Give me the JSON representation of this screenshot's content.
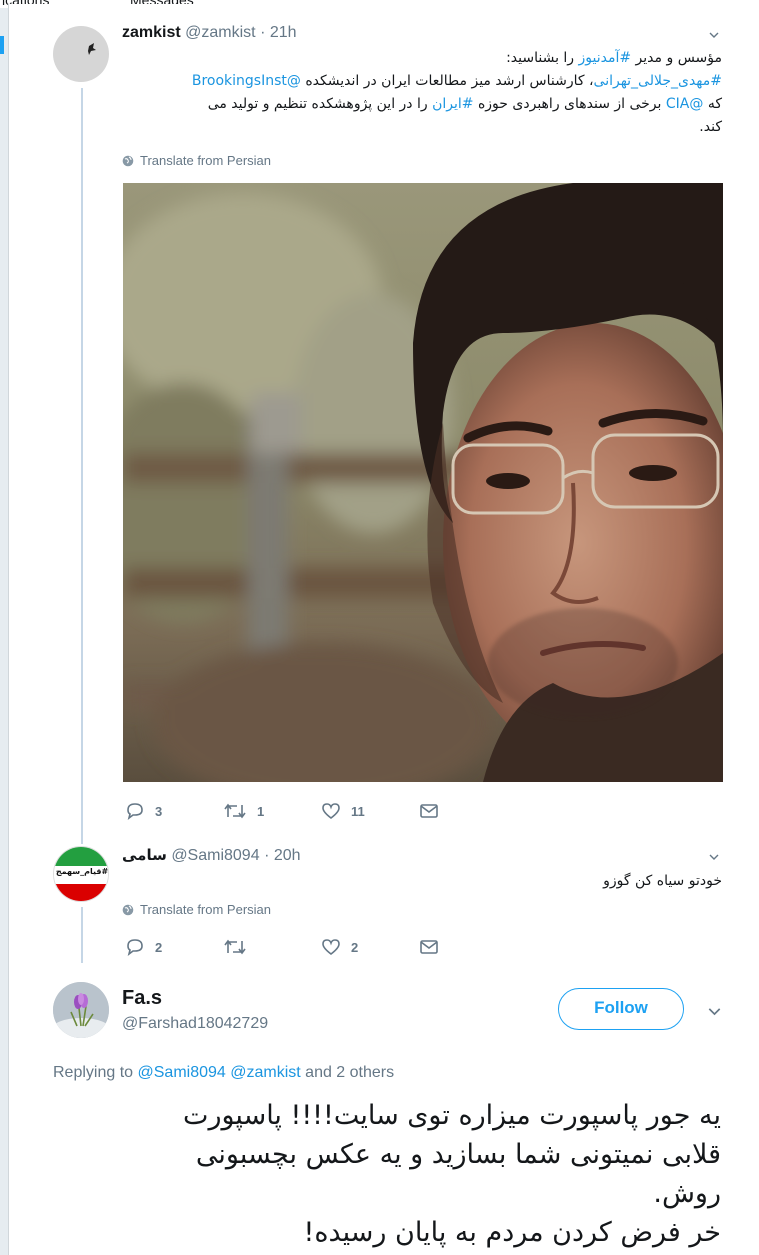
{
  "topbar": {
    "tab_notifications": "ications",
    "tab_messages": "Messages"
  },
  "tweet1": {
    "name": "zamkist",
    "handle": "@zamkist",
    "time": "· 21h",
    "line1_text": "مؤسس و مدیر ",
    "line1_link": "#آمدنیوز",
    "line1_end": " را بشناسید:",
    "line2_link1": "#مهدی_جلالی_تهرانی",
    "line2_text": "، کارشناس ارشد میز مطالعات ایران در اندیشکده ",
    "line2_link2": "@BrookingsInst",
    "line3_a": "که ",
    "line3_link1": "@CIA",
    "line3_b": " برخی از سندهای راهبردی حوزه ",
    "line3_link2": "#ایران",
    "line3_c": " را در این پژوهشکده تنظیم و تولید می",
    "line4": "کند.",
    "translate": "Translate from Persian",
    "replies": "3",
    "retweets": "1",
    "likes": "11"
  },
  "tweet2": {
    "name": "سامی",
    "handle": "@Sami8094",
    "time": "· 20h",
    "text": "خودتو سیاه کن گوزو",
    "translate": "Translate from Persian",
    "replies": "2",
    "retweets": "",
    "likes": "2",
    "avatar_text": "#قیام_سهمج"
  },
  "tweet3": {
    "name": "Fa.s",
    "handle": "@Farshad18042729",
    "follow_label": "Follow",
    "replying_prefix": "Replying to ",
    "reply_to1": "@Sami8094",
    "reply_to2": "@zamkist",
    "reply_suffix": " and 2 others",
    "line1": "یه جور پاسپورت میزاره توی سایت!!!! پاسپورت",
    "line2": "قلابی نمیتونی شما بسازید و یه عکس بچسبونی",
    "line3": "روش.",
    "line4": "خر فرض کردن مردم به پایان رسیده!"
  },
  "colors": {
    "link": "#1b95e0",
    "muted": "#657786",
    "accent": "#1da1f2"
  }
}
